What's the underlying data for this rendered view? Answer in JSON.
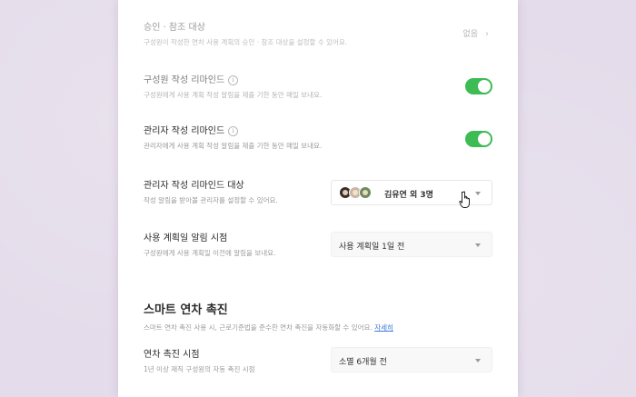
{
  "colors": {
    "toggle_on": "#3dbb55",
    "link": "#3a78d8",
    "background": "#e4dcea"
  },
  "approval": {
    "title": "승인 · 참조 대상",
    "desc": "구성원이 작성한 연차 사용 계획의 승인 · 참조 대상을 설정할 수 있어요.",
    "value": "없음",
    "chevron": "›"
  },
  "member_reminder": {
    "title": "구성원 작성 리마인드",
    "info": "i",
    "desc": "구성원에게 사용 계획 작성 알림을 제출 기한 동안 매일 보내요.",
    "enabled": true
  },
  "admin_reminder": {
    "title": "관리자 작성 리마인드",
    "info": "i",
    "desc": "관리자에게 사용 계획 작성 알림을 제출 기한 동안 매일 보내요.",
    "enabled": true
  },
  "admin_target": {
    "title": "관리자 작성 리마인드 대상",
    "desc": "작성 알림을 받아볼 관리자를 설정할 수 있어요.",
    "selected": "김유연 외 3명",
    "avatars": [
      "user-avatar-1",
      "user-avatar-2",
      "user-avatar-3"
    ]
  },
  "plan_alert": {
    "title": "사용 계획일 알림 시점",
    "desc": "구성원에게 사용 계획일 이전에 알림을 보내요.",
    "selected": "사용 계획일 1일 전"
  },
  "smart": {
    "title": "스마트 연차 촉진",
    "desc": "스마트 연차 촉진 사용 시, 근로기준법을 준수한 연차 촉진을 자동화할 수 있어요.",
    "link": "자세히"
  },
  "promotion": {
    "title": "연차 촉진 시점",
    "desc": "1년 이상 재직 구성원의 자동 촉진 시점",
    "selected": "소멸 6개월 전"
  }
}
